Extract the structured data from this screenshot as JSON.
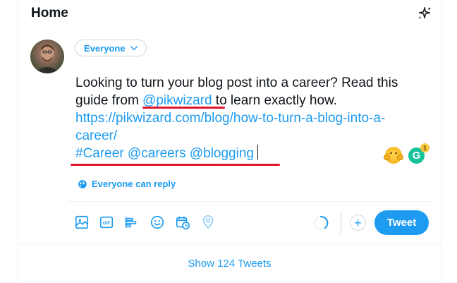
{
  "header": {
    "title": "Home",
    "sparkle_icon": "sparkle-icon"
  },
  "composer": {
    "audience_label": "Everyone",
    "lines": {
      "l1": "Looking to turn your blog post into a career? Read this",
      "l2_pre": "guide from ",
      "l2_mention": "@pikwizard",
      "l2_post": " to learn exactly how.",
      "l3_link": "https://pikwizard.com/blog/how-to-turn-a-blog-into-a-",
      "l4_link": "career/",
      "l5_tags": "#Career @careers @blogging"
    },
    "reply_setting": "Everyone can reply",
    "grammarly_letter": "G",
    "grammarly_count": "1"
  },
  "toolbar": {
    "icons": [
      "media-icon",
      "gif-icon",
      "poll-icon",
      "emoji-icon",
      "schedule-icon",
      "location-icon"
    ],
    "plus_label": "+",
    "tweet_label": "Tweet"
  },
  "timeline": {
    "show_tweets_label": "Show 124 Tweets"
  },
  "colors": {
    "accent": "#1d9bf0",
    "annotation": "#e0162b",
    "text": "#0f1419"
  }
}
